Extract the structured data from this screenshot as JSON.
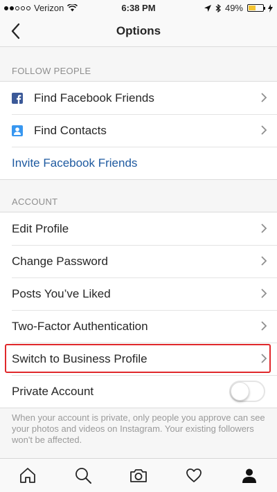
{
  "status_bar": {
    "carrier": "Verizon",
    "time": "6:38 PM",
    "battery_percent": "49%",
    "battery_level": 0.49,
    "battery_color": "#f4c430"
  },
  "nav": {
    "title": "Options",
    "back_icon": "chevron-left-icon"
  },
  "follow_section": {
    "header": "FOLLOW PEOPLE",
    "items": [
      {
        "label": "Find Facebook Friends",
        "icon": "facebook-icon"
      },
      {
        "label": "Find Contacts",
        "icon": "contacts-icon"
      },
      {
        "label": "Invite Facebook Friends"
      }
    ]
  },
  "account_section": {
    "header": "ACCOUNT",
    "items": [
      {
        "label": "Edit Profile"
      },
      {
        "label": "Change Password"
      },
      {
        "label": "Posts You’ve Liked"
      },
      {
        "label": "Two-Factor Authentication"
      },
      {
        "label": "Switch to Business Profile",
        "highlighted": true
      },
      {
        "label": "Private Account",
        "toggle": false
      }
    ],
    "private_note": "When your account is private, only people you approve can see your photos and videos on Instagram. Your existing followers won't be affected."
  },
  "tab_bar": {
    "tabs": [
      "home-icon",
      "search-icon",
      "camera-icon",
      "heart-icon",
      "profile-icon"
    ],
    "active": "profile-icon"
  },
  "colors": {
    "link": "#1e5aa0",
    "highlight": "#e0282b",
    "facebook": "#3b5998",
    "contacts": "#3897f0"
  }
}
